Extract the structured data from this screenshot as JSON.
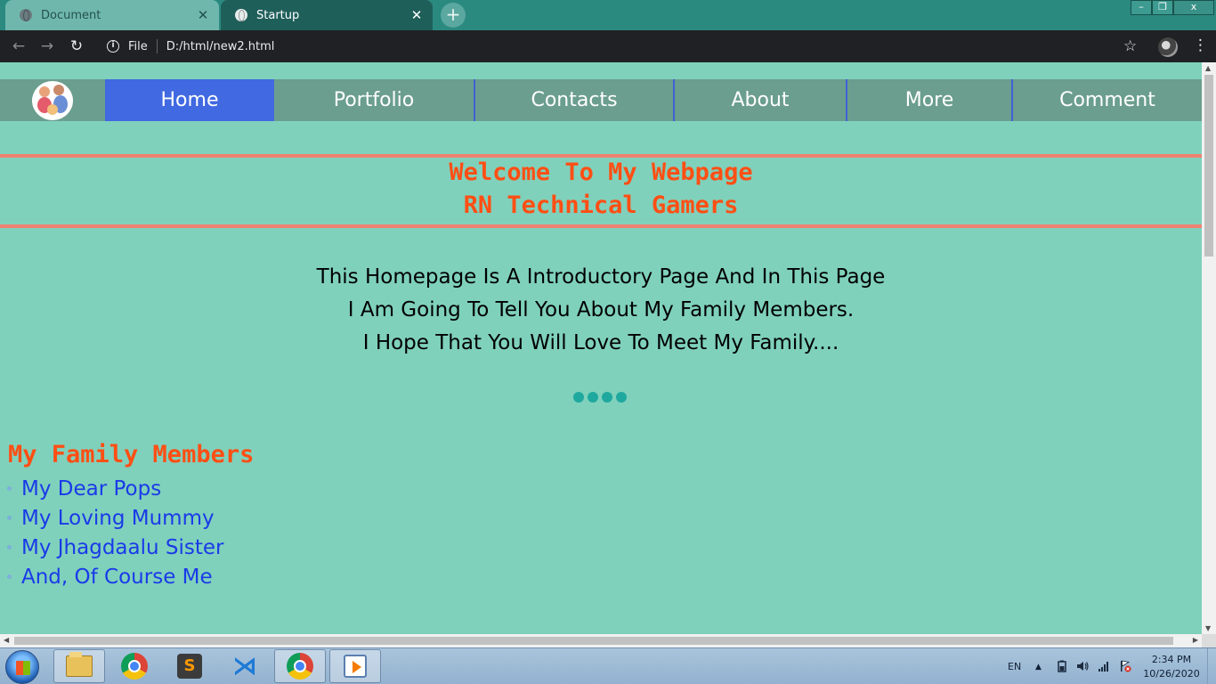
{
  "browser": {
    "tabs": [
      {
        "title": "Document",
        "active": false
      },
      {
        "title": "Startup",
        "active": true
      }
    ],
    "new_tab": "+",
    "window_controls": {
      "minimize": "–",
      "maximize": "❐",
      "close": "x"
    },
    "omnibox": {
      "scheme": "File",
      "url": "D:/html/new2.html"
    }
  },
  "site": {
    "nav": [
      "Home",
      "Portfolio",
      "Contacts",
      "About",
      "More",
      "Comment"
    ],
    "active_nav": "Home",
    "welcome": [
      "Welcome To My Webpage",
      "RN Technical Gamers"
    ],
    "intro": [
      "This Homepage Is A Introductory Page And In This Page",
      "I Am Going To Tell You About My Family Members.",
      "I Hope That You Will Love To Meet My Family...."
    ],
    "family_heading": "My Family Members",
    "family": [
      "My Dear Pops",
      "My Loving Mummy",
      "My Jhagdaalu Sister",
      "And, Of Course Me"
    ]
  },
  "colors": {
    "page_bg": "#7fd1bc",
    "nav_bg": "#6b9e8e",
    "nav_active": "#4169e1",
    "heading": "#ff4f14",
    "band_line": "#f08070",
    "link": "#1a3ae8"
  },
  "taskbar": {
    "apps": [
      "file-explorer",
      "google-chrome",
      "sublime-text",
      "visual-studio-code",
      "google-chrome-active",
      "media-player"
    ],
    "sublime_glyph": "S",
    "vscode_glyph": "⋊",
    "language": "EN",
    "tray_expand": "▲",
    "time": "2:34 PM",
    "date": "10/26/2020"
  }
}
